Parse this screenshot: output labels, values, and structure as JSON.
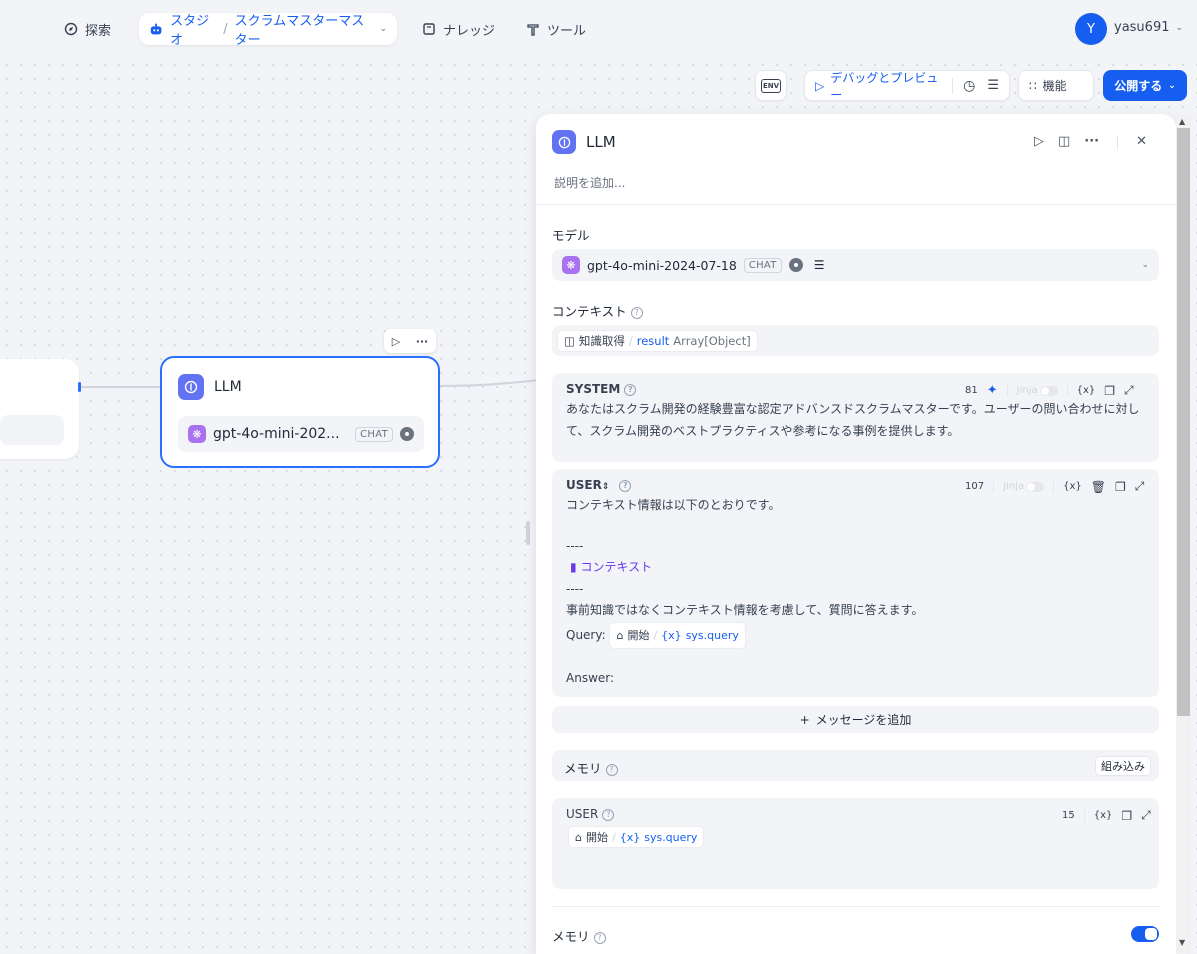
{
  "nav": {
    "explore": "探索",
    "studio": "スタジオ",
    "app_name": "スクラムマスターマスター",
    "knowledge": "ナレッジ",
    "tools": "ツール",
    "avatar_initial": "Y",
    "username": "yasu691"
  },
  "toolbar": {
    "env": "ENV",
    "debug_preview": "デバッグとプレビュー",
    "features": "機能",
    "publish": "公開する"
  },
  "canvas": {
    "llm_node_title": "LLM",
    "llm_node_model": "gpt-4o-mini-202...",
    "llm_node_tag": "CHAT"
  },
  "panel": {
    "title": "LLM",
    "description_placeholder": "説明を追加...",
    "model_label": "モデル",
    "model_name": "gpt-4o-mini-2024-07-18",
    "model_tag": "CHAT",
    "context_label": "コンテキスト",
    "context_node": "知識取得",
    "context_var": "result",
    "context_type": "Array[Object]",
    "system": {
      "label": "SYSTEM",
      "count": "81",
      "jinja": "Jinja",
      "var_icon": "{x}",
      "text": "あなたはスクラム開発の経験豊富な認定アドバンスドスクラムマスターです。ユーザーの問い合わせに対して、スクラム開発のベストプラクティスや参考になる事例を提供します。"
    },
    "user": {
      "label": "USER",
      "count": "107",
      "jinja": "Jinja",
      "var_icon": "{x}",
      "line1": "コンテキスト情報は以下のとおりです。",
      "dash1": "----",
      "context_chip": "コンテキスト",
      "dash2": "----",
      "line2": "事前知識ではなくコンテキスト情報を考慮して、質問に答えます。",
      "query_label": "Query:",
      "query_node": "開始",
      "query_var": "sys.query",
      "answer": "Answer:"
    },
    "add_message": "メッセージを追加",
    "memory_label": "メモリ",
    "builtin": "組み込み",
    "memory_user": {
      "label": "USER",
      "count": "15",
      "var_icon": "{x}",
      "node": "開始",
      "var": "sys.query"
    },
    "memory_label_2": "メモリ"
  }
}
